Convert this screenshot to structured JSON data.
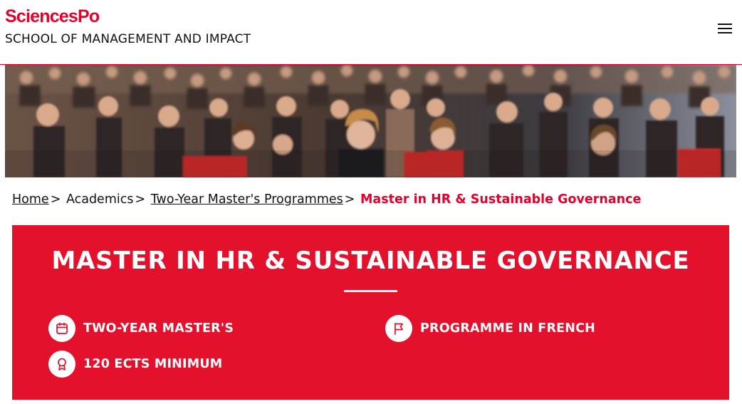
{
  "header": {
    "logo_text": "SciencesPo",
    "school_name": "SCHOOL OF MANAGEMENT AND IMPACT",
    "menu_icon": "hamburger-menu-icon"
  },
  "hero": {
    "image_subject": "lecture-hall-audience-photo"
  },
  "breadcrumb": {
    "home": "Home",
    "academics": "Academics",
    "programmes": "Two-Year Master's Programmes",
    "current": "Master in HR & Sustainable Governance",
    "separator": ">"
  },
  "banner": {
    "title": "MASTER IN HR & SUSTAINABLE GOVERNANCE",
    "features": [
      {
        "icon": "calendar-icon",
        "label": "TWO-YEAR MASTER'S"
      },
      {
        "icon": "flag-icon",
        "label": "PROGRAMME IN FRENCH"
      },
      {
        "icon": "award-ribbon-icon",
        "label": "120 ECTS MINIMUM"
      }
    ]
  },
  "colors": {
    "brand_red": "#e4002b",
    "banner_red": "#e4112d",
    "white": "#ffffff"
  }
}
